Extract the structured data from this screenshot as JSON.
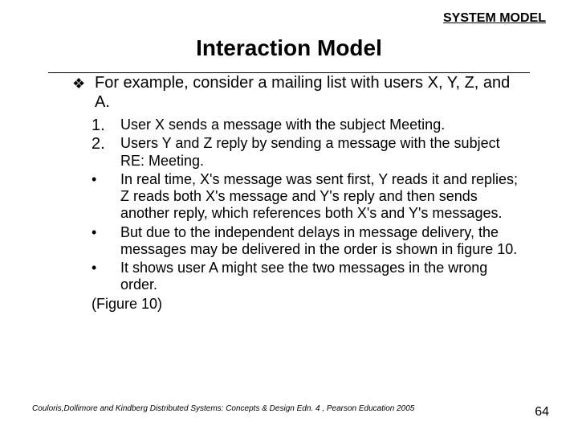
{
  "header": {
    "label": "SYSTEM MODEL"
  },
  "title": "Interaction Model",
  "lead": {
    "bullet_glyph": "❖",
    "text": "For example, consider a mailing list with users X, Y, Z, and A."
  },
  "items": [
    {
      "marker": "1.",
      "text": "User X sends a message with the subject Meeting."
    },
    {
      "marker": "2.",
      "text": "Users Y and Z reply by sending a message with the subject RE: Meeting."
    },
    {
      "marker": "•",
      "text": "In real time, X's message was sent first, Y reads it and replies; Z reads both X's message and Y's reply and then sends another reply, which references both X's and Y's messages."
    },
    {
      "marker": "•",
      "text": "But due to the independent delays in message delivery, the messages may be delivered in the order is shown in figure 10."
    },
    {
      "marker": "•",
      "text": "It shows user A might see the two messages in the wrong order."
    }
  ],
  "figure_ref": "(Figure 10)",
  "citation": "Couloris,Dollimore and Kindberg  Distributed Systems: Concepts & Design  Edn. 4 , Pearson Education 2005",
  "page_number": "64"
}
